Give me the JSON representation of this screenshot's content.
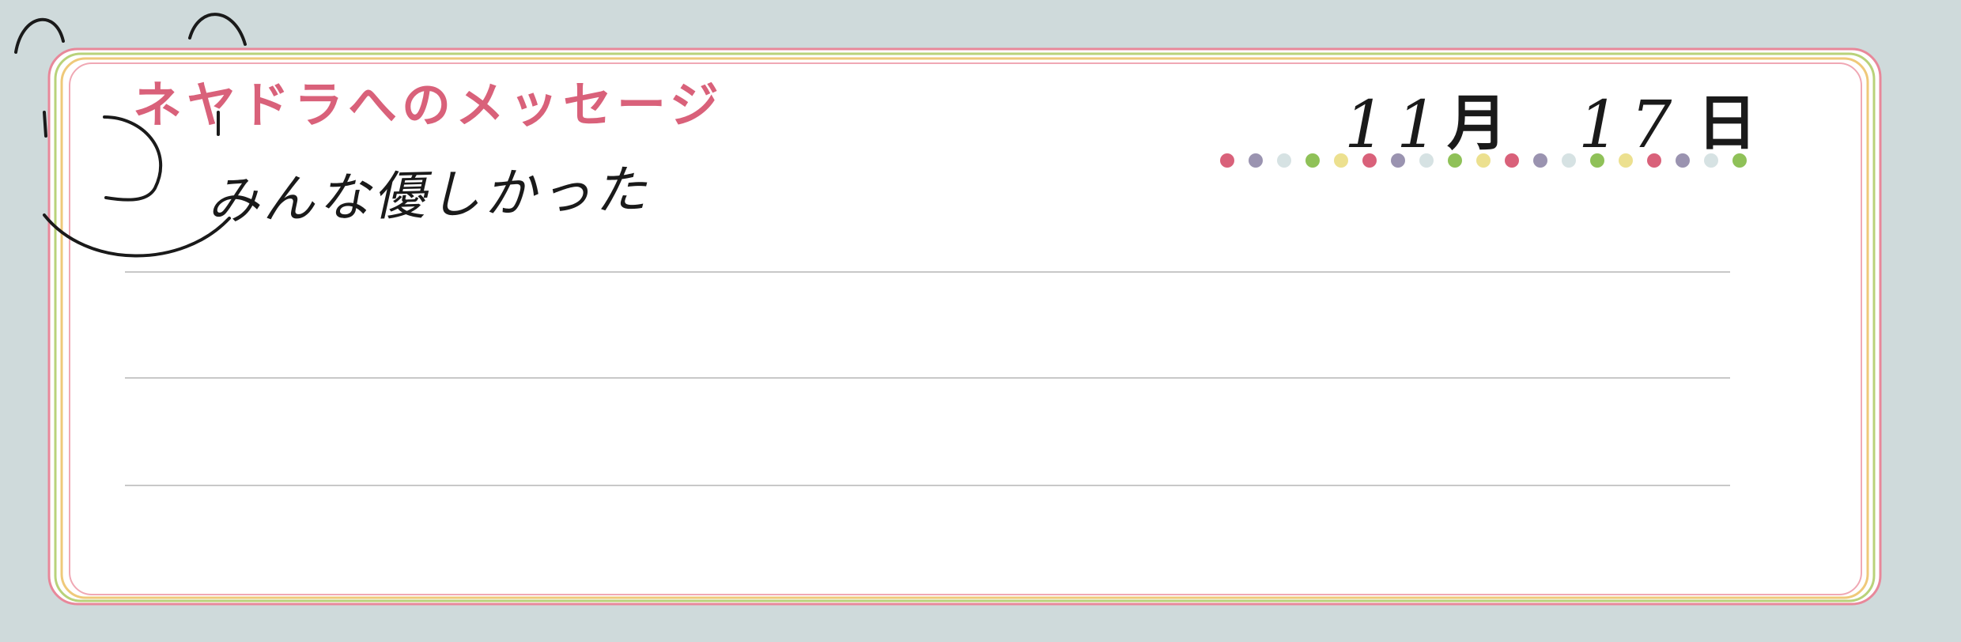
{
  "title": "ネヤドラへのメッセージ",
  "message": "みんな優しかった",
  "date": {
    "month": "11",
    "month_unit": "月",
    "day": "17",
    "day_unit": "日"
  },
  "colors": {
    "background": "#cfdadb",
    "card": "#ffffff",
    "title": "#d9617a",
    "ink": "#1a1a1a",
    "border_outer": "#e8889a",
    "border_middle_1": "#b9d27a",
    "border_middle_2": "#efc97a",
    "border_inner": "#f0a8b4",
    "ruled_line": "#c8c8c8",
    "dots": [
      "#d9617a",
      "#9a93b0",
      "#d6e2e3",
      "#8fc158",
      "#ece08f"
    ]
  },
  "drawing": {
    "subject": "smiley-face"
  },
  "ruled_lines_count": 3
}
